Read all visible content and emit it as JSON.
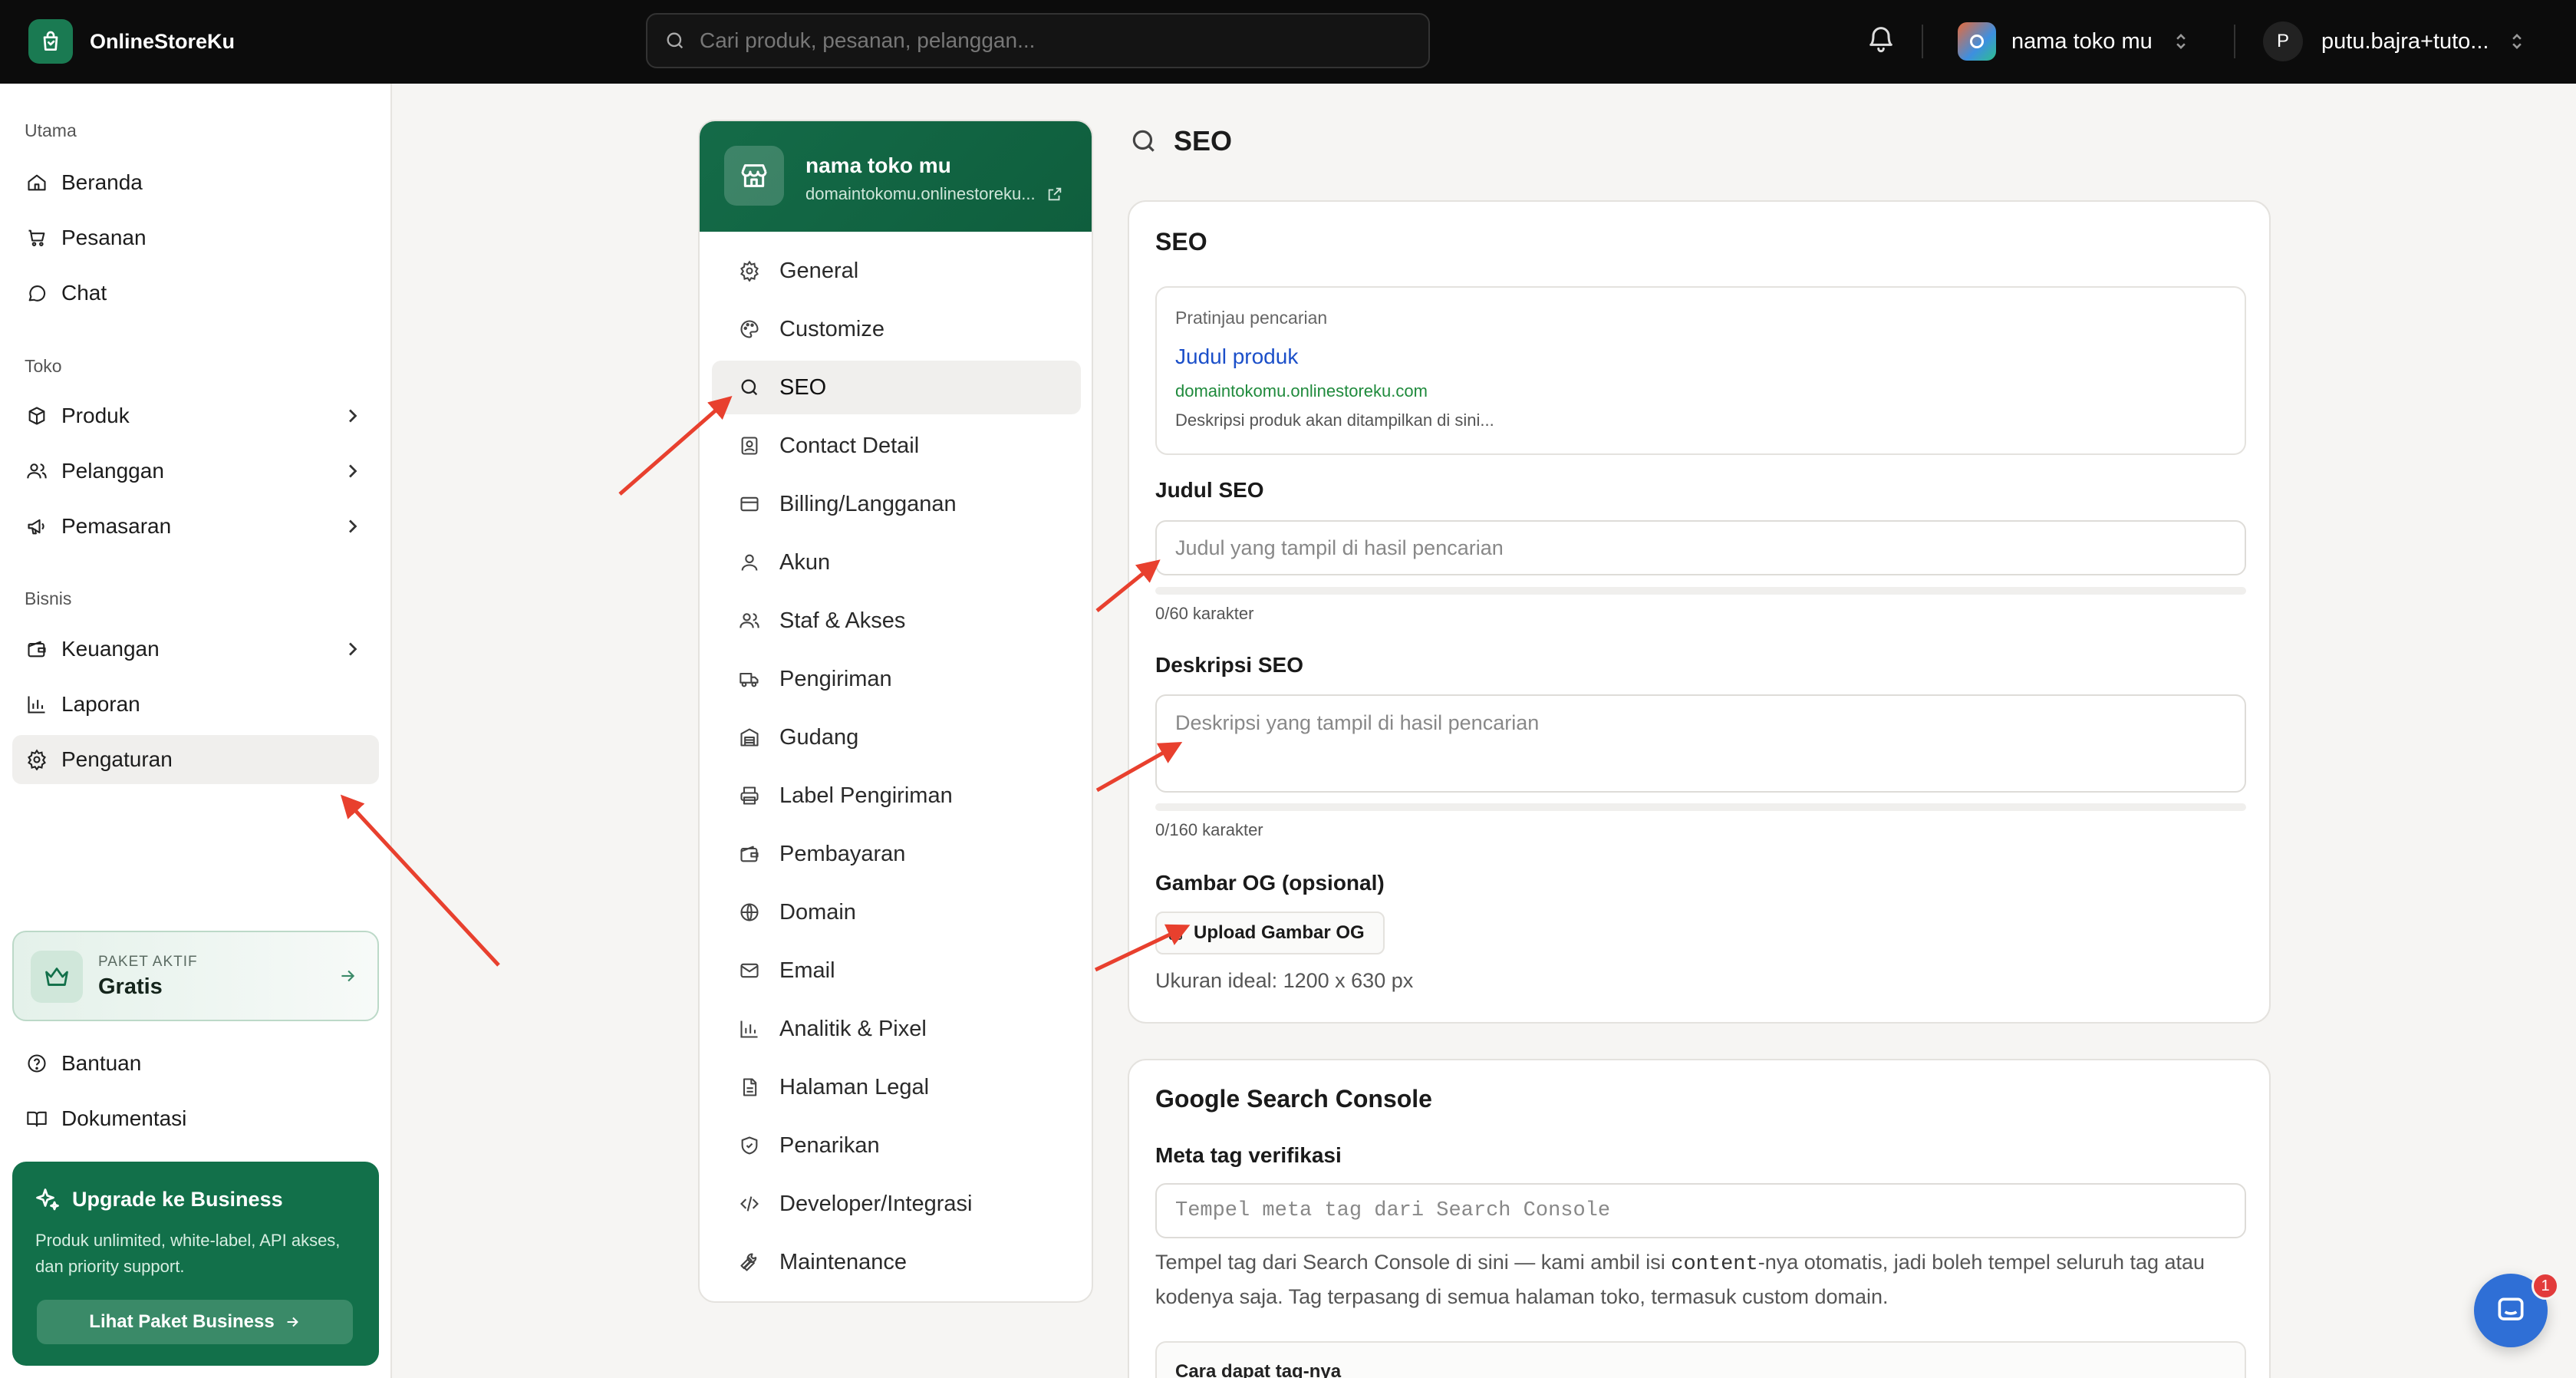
{
  "topbar": {
    "brand": "OnlineStoreKu",
    "search_placeholder": "Cari produk, pesanan, pelanggan...",
    "store_name": "nama toko mu",
    "user_initial": "P",
    "user_name": "putu.bajra+tuto..."
  },
  "sidebar": {
    "section_main": "Utama",
    "section_store": "Toko",
    "section_business": "Bisnis",
    "items": [
      {
        "label": "Beranda"
      },
      {
        "label": "Pesanan"
      },
      {
        "label": "Chat"
      },
      {
        "label": "Produk"
      },
      {
        "label": "Pelanggan"
      },
      {
        "label": "Pemasaran"
      },
      {
        "label": "Keuangan"
      },
      {
        "label": "Laporan"
      },
      {
        "label": "Pengaturan"
      }
    ],
    "plan_label": "PAKET AKTIF",
    "plan_value": "Gratis",
    "help": "Bantuan",
    "docs": "Dokumentasi",
    "upgrade_title": "Upgrade ke Business",
    "upgrade_desc": "Produk unlimited, white-label, API akses, dan priority support.",
    "upgrade_button": "Lihat Paket Business"
  },
  "settings": {
    "store_name": "nama toko mu",
    "domain": "domaintokomu.onlinestoreku...",
    "menu": [
      {
        "label": "General"
      },
      {
        "label": "Customize"
      },
      {
        "label": "SEO"
      },
      {
        "label": "Contact Detail"
      },
      {
        "label": "Billing/Langganan"
      },
      {
        "label": "Akun"
      },
      {
        "label": "Staf & Akses"
      },
      {
        "label": "Pengiriman"
      },
      {
        "label": "Gudang"
      },
      {
        "label": "Label Pengiriman"
      },
      {
        "label": "Pembayaran"
      },
      {
        "label": "Domain"
      },
      {
        "label": "Email"
      },
      {
        "label": "Analitik & Pixel"
      },
      {
        "label": "Halaman Legal"
      },
      {
        "label": "Penarikan"
      },
      {
        "label": "Developer/Integrasi"
      },
      {
        "label": "Maintenance"
      }
    ]
  },
  "content": {
    "page_title": "SEO",
    "seo_card": {
      "title": "SEO",
      "preview_label": "Pratinjau pencarian",
      "preview_title": "Judul produk",
      "preview_url": "domaintokomu.onlinestoreku.com",
      "preview_desc": "Deskripsi produk akan ditampilkan di sini...",
      "title_label": "Judul SEO",
      "title_placeholder": "Judul yang tampil di hasil pencarian",
      "title_counter": "0/60 karakter",
      "title_fill": 0,
      "desc_label": "Deskripsi SEO",
      "desc_placeholder": "Deskripsi yang tampil di hasil pencarian",
      "desc_counter": "0/160 karakter",
      "desc_fill": 0,
      "og_label": "Gambar OG (opsional)",
      "og_button": "Upload Gambar OG",
      "og_hint": "Ukuran ideal: 1200 x 630 px"
    },
    "gsc_card": {
      "title": "Google Search Console",
      "meta_label": "Meta tag verifikasi",
      "meta_placeholder": "Tempel meta tag dari Search Console",
      "help_before": "Tempel tag dari Search Console di sini — kami ambil isi ",
      "help_code": "content",
      "help_after": "-nya otomatis, jadi boleh tempel seluruh tag atau kodenya saja. Tag terpasang di semua halaman toko, termasuk custom domain.",
      "howto": "Cara dapat tag-nya"
    }
  },
  "chat_widget": {
    "badge": "1"
  },
  "colors": {
    "brand_green": "#12704a",
    "annotation_red": "#e8402e",
    "link_blue": "#1b4fc9",
    "url_green": "#1f8a3c"
  }
}
